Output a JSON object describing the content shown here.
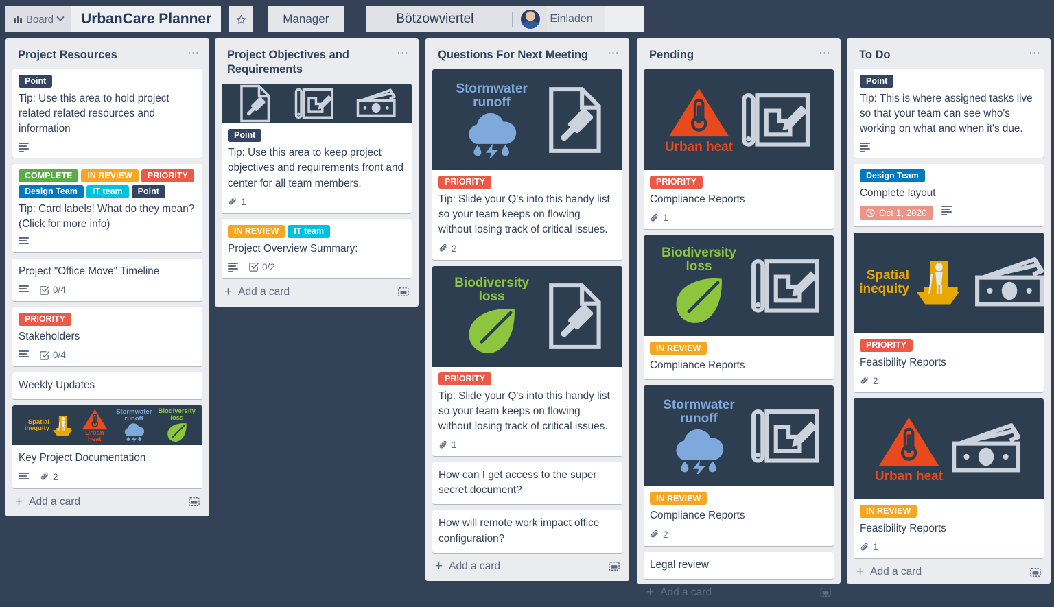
{
  "topbar": {
    "board_button_label": "Board",
    "board_icon": "board-grid-icon",
    "chevron_icon": "chevron-down-icon",
    "board_title": "UrbanCare Planner",
    "star_icon": "star-icon",
    "manager_label": "Manager",
    "team_name": "Bötzowviertel",
    "avatar_icon": "user-avatar",
    "invite_label": "Einladen"
  },
  "colors": {
    "board_bg": "#344258",
    "list_bg": "#ebecf0",
    "card_bg": "#ffffff",
    "cover_bg": "#2d3e50",
    "label_complete": "#5aac44",
    "label_in_review": "#f5a623",
    "label_priority": "#eb5a46",
    "label_design_team": "#0079bf",
    "label_it_team": "#00c2e0",
    "label_point": "#344563",
    "due_badge": "#ec9488",
    "urban_heat": "#e8491d",
    "spatial_inequity": "#e8a800",
    "stormwater": "#7fa9dd",
    "biodiversity": "#8cc63f",
    "doc_gray": "#ccd3dc"
  },
  "add_card": {
    "label": "Add a card",
    "plus_icon": "plus-icon",
    "template_icon": "card-template-icon"
  },
  "list_menu_icon": "list-menu-ellipsis-icon",
  "lists": [
    {
      "title": "Project Resources",
      "cards": [
        {
          "labels": [
            {
              "text": "Point",
              "color": "#344563"
            }
          ],
          "text": "Tip: Use this area to hold project related related resources and information",
          "badges": [
            {
              "type": "description",
              "icon": "description-icon",
              "value": ""
            }
          ]
        },
        {
          "labels": [
            {
              "text": "COMPLETE",
              "color": "#5aac44"
            },
            {
              "text": "IN REVIEW",
              "color": "#f5a623"
            },
            {
              "text": "PRIORITY",
              "color": "#eb5a46"
            },
            {
              "text": "Design Team",
              "color": "#0079bf"
            },
            {
              "text": "IT team",
              "color": "#00c2e0"
            },
            {
              "text": "Point",
              "color": "#344563"
            }
          ],
          "text": "Tip: Card labels! What do they mean? (Click for more info)",
          "badges": [
            {
              "type": "description",
              "icon": "description-icon",
              "value": ""
            }
          ]
        },
        {
          "labels": [],
          "text": "Project \"Office Move\" Timeline",
          "badges": [
            {
              "type": "description",
              "icon": "description-icon",
              "value": ""
            },
            {
              "type": "checklist",
              "icon": "checklist-icon",
              "value": "0/4"
            }
          ]
        },
        {
          "labels": [
            {
              "text": "PRIORITY",
              "color": "#eb5a46"
            }
          ],
          "text": "Stakeholders",
          "badges": [
            {
              "type": "description",
              "icon": "description-icon",
              "value": ""
            },
            {
              "type": "checklist",
              "icon": "checklist-icon",
              "value": "0/4"
            }
          ]
        },
        {
          "labels": [],
          "text": "Weekly Updates",
          "badges": []
        },
        {
          "cover": {
            "style": "strip",
            "items": [
              {
                "caption": "Spatial inequity",
                "caption_color": "#e8a800",
                "caption_pos": "left",
                "art": "spatial-inequity-icon"
              },
              {
                "caption": "Urban heat",
                "caption_color": "#e8491d",
                "caption_pos": "bottom",
                "art": "urban-heat-icon"
              },
              {
                "caption": "Stormwater runoff",
                "caption_color": "#7fa9dd",
                "caption_pos": "top",
                "art": "stormwater-icon"
              },
              {
                "caption": "Biodiversity loss",
                "caption_color": "#8cc63f",
                "caption_pos": "top",
                "art": "biodiversity-icon"
              }
            ]
          },
          "labels": [],
          "text": "Key Project Documentation",
          "badges": [
            {
              "type": "description",
              "icon": "description-icon",
              "value": ""
            },
            {
              "type": "attachment",
              "icon": "attachment-icon",
              "value": "2"
            }
          ]
        }
      ]
    },
    {
      "title": "Project Objectives and Requirements",
      "cards": [
        {
          "cover": {
            "style": "tall-icons",
            "height": 58,
            "items": [
              {
                "art": "gavel-document-icon"
              },
              {
                "art": "blueprint-pencil-icon"
              },
              {
                "art": "money-icon"
              }
            ]
          },
          "labels": [
            {
              "text": "Point",
              "color": "#344563"
            }
          ],
          "text": "Tip: Use this area to keep project objectives and requirements front and center for all team members.",
          "badges": [
            {
              "type": "attachment",
              "icon": "attachment-icon",
              "value": "1"
            }
          ]
        },
        {
          "labels": [
            {
              "text": "IN REVIEW",
              "color": "#f5a623"
            },
            {
              "text": "IT team",
              "color": "#00c2e0"
            }
          ],
          "text": "Project Overview Summary:",
          "badges": [
            {
              "type": "description",
              "icon": "description-icon",
              "value": ""
            },
            {
              "type": "checklist",
              "icon": "checklist-icon",
              "value": "0/2"
            }
          ]
        }
      ]
    },
    {
      "title": "Questions For Next Meeting",
      "cards": [
        {
          "cover": {
            "style": "tall",
            "items": [
              {
                "caption": "Stormwater runoff",
                "caption_color": "#7fa9dd",
                "caption_pos": "top",
                "art": "stormwater-icon"
              },
              {
                "art": "gavel-document-icon"
              }
            ]
          },
          "labels": [
            {
              "text": "PRIORITY",
              "color": "#eb5a46"
            }
          ],
          "text": "Tip: Slide your Q's into this handy list so your team keeps on flowing without losing track of critical issues.",
          "badges": [
            {
              "type": "attachment",
              "icon": "attachment-icon",
              "value": "2"
            }
          ]
        },
        {
          "cover": {
            "style": "tall",
            "items": [
              {
                "caption": "Biodiversity loss",
                "caption_color": "#8cc63f",
                "caption_pos": "top",
                "art": "biodiversity-icon"
              },
              {
                "art": "gavel-document-icon"
              }
            ]
          },
          "labels": [
            {
              "text": "PRIORITY",
              "color": "#eb5a46"
            }
          ],
          "text": "Tip: Slide your Q's into this handy list so your team keeps on flowing without losing track of critical issues.",
          "badges": [
            {
              "type": "attachment",
              "icon": "attachment-icon",
              "value": "1"
            }
          ]
        },
        {
          "labels": [],
          "text": "How can I get access to the super secret document?",
          "badges": []
        },
        {
          "labels": [],
          "text": "How will remote work impact office configuration?",
          "badges": []
        }
      ]
    },
    {
      "title": "Pending",
      "cards": [
        {
          "cover": {
            "style": "tall",
            "items": [
              {
                "caption": "Urban heat",
                "caption_color": "#e8491d",
                "caption_pos": "bottom",
                "art": "urban-heat-icon"
              },
              {
                "art": "blueprint-pencil-icon"
              }
            ]
          },
          "labels": [
            {
              "text": "PRIORITY",
              "color": "#eb5a46"
            }
          ],
          "text": "Compliance Reports",
          "badges": [
            {
              "type": "attachment",
              "icon": "attachment-icon",
              "value": "1"
            }
          ]
        },
        {
          "cover": {
            "style": "tall",
            "items": [
              {
                "caption": "Biodiversity loss",
                "caption_color": "#8cc63f",
                "caption_pos": "top",
                "art": "biodiversity-icon"
              },
              {
                "art": "blueprint-pencil-icon"
              }
            ]
          },
          "labels": [
            {
              "text": "IN REVIEW",
              "color": "#f5a623"
            }
          ],
          "text": "Compliance Reports",
          "badges": []
        },
        {
          "cover": {
            "style": "tall",
            "items": [
              {
                "caption": "Stormwater runoff",
                "caption_color": "#7fa9dd",
                "caption_pos": "top",
                "art": "stormwater-icon"
              },
              {
                "art": "blueprint-pencil-icon"
              }
            ]
          },
          "labels": [
            {
              "text": "IN REVIEW",
              "color": "#f5a623"
            }
          ],
          "text": "Compliance Reports",
          "badges": [
            {
              "type": "attachment",
              "icon": "attachment-icon",
              "value": "2"
            }
          ]
        },
        {
          "labels": [],
          "text": "Legal review",
          "badges": []
        }
      ]
    },
    {
      "title": "To Do",
      "cards": [
        {
          "labels": [
            {
              "text": "Point",
              "color": "#344563"
            }
          ],
          "text": "Tip: This is where assigned tasks live so that your team can see who's working on what and when it's due.",
          "badges": [
            {
              "type": "description",
              "icon": "description-icon",
              "value": ""
            }
          ]
        },
        {
          "labels": [
            {
              "text": "Design Team",
              "color": "#0079bf"
            }
          ],
          "text": "Complete layout",
          "due": {
            "text": "Oct 1, 2020",
            "icon": "clock-icon"
          },
          "badges": [
            {
              "type": "description",
              "icon": "description-icon",
              "value": ""
            }
          ]
        },
        {
          "cover": {
            "style": "tall",
            "items": [
              {
                "caption": "Spatial inequity",
                "caption_color": "#e8a800",
                "caption_pos": "left",
                "art": "spatial-inequity-icon"
              },
              {
                "art": "money-icon"
              }
            ]
          },
          "labels": [
            {
              "text": "PRIORITY",
              "color": "#eb5a46"
            }
          ],
          "text": "Feasibility Reports",
          "badges": [
            {
              "type": "attachment",
              "icon": "attachment-icon",
              "value": "2"
            }
          ]
        },
        {
          "cover": {
            "style": "tall",
            "items": [
              {
                "caption": "Urban heat",
                "caption_color": "#e8491d",
                "caption_pos": "bottom",
                "art": "urban-heat-icon"
              },
              {
                "art": "money-icon"
              }
            ]
          },
          "labels": [
            {
              "text": "IN REVIEW",
              "color": "#f5a623"
            }
          ],
          "text": "Feasibility Reports",
          "badges": [
            {
              "type": "attachment",
              "icon": "attachment-icon",
              "value": "1"
            }
          ]
        }
      ]
    }
  ]
}
